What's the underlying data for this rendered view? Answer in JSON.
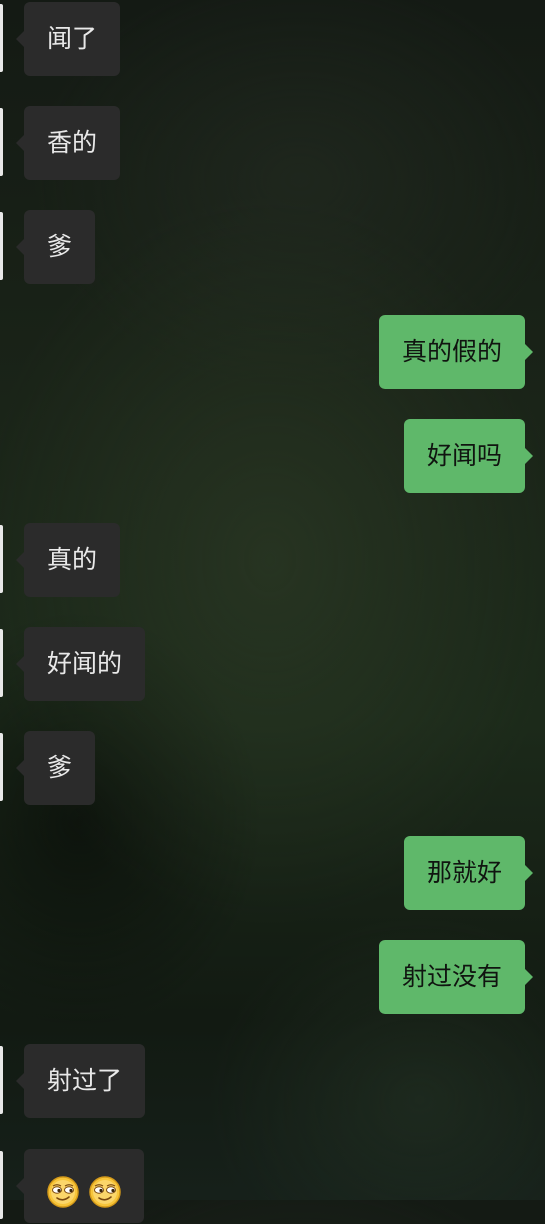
{
  "messages": [
    {
      "from": "other",
      "text": "闻了"
    },
    {
      "from": "other",
      "text": "香的"
    },
    {
      "from": "other",
      "text": "爹"
    },
    {
      "from": "me",
      "text": "真的假的"
    },
    {
      "from": "me",
      "text": "好闻吗"
    },
    {
      "from": "other",
      "text": "真的"
    },
    {
      "from": "other",
      "text": "好闻的"
    },
    {
      "from": "other",
      "text": "爹"
    },
    {
      "from": "me",
      "text": "那就好"
    },
    {
      "from": "me",
      "text": "射过没有"
    },
    {
      "from": "other",
      "text": "射过了"
    },
    {
      "from": "other",
      "emoji": [
        "smirk-emoji",
        "smirk-emoji"
      ]
    }
  ],
  "colors": {
    "incoming_bubble": "#2b2b2b",
    "outgoing_bubble": "#5fb86a",
    "incoming_text": "#e9e9e9",
    "outgoing_text": "#101410"
  }
}
